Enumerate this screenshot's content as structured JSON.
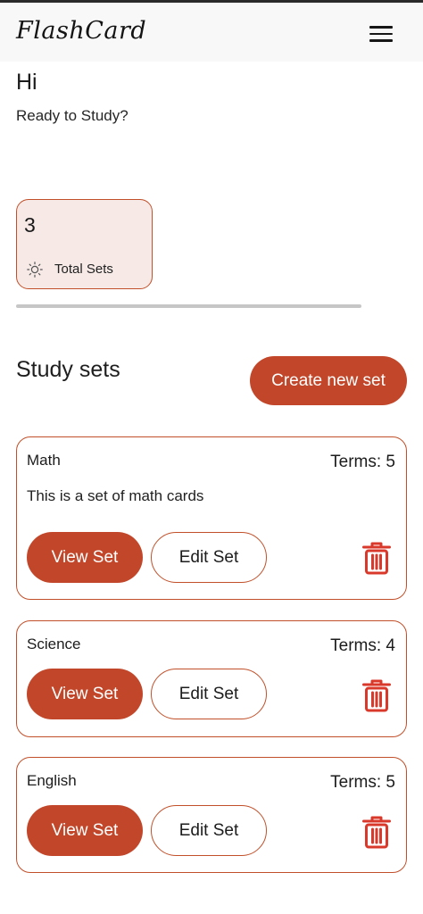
{
  "header": {
    "logo": "FlashCard",
    "menu_icon": "hamburger-menu-icon"
  },
  "greeting": {
    "title": "Hi",
    "subtitle": "Ready to Study?"
  },
  "stats": {
    "total_sets_value": "3",
    "total_sets_label": "Total Sets",
    "icon": "sun-icon"
  },
  "study_sets": {
    "section_title": "Study sets",
    "create_label": "Create new set",
    "sets": [
      {
        "title": "Math",
        "terms": "Terms: 5",
        "description": "This is a set of math cards",
        "view_label": "View Set",
        "edit_label": "Edit Set",
        "delete_icon": "trash-icon"
      },
      {
        "title": "Science",
        "terms": "Terms: 4",
        "description": "",
        "view_label": "View Set",
        "edit_label": "Edit Set",
        "delete_icon": "trash-icon"
      },
      {
        "title": "English",
        "terms": "Terms: 5",
        "description": "",
        "view_label": "View Set",
        "edit_label": "Edit Set",
        "delete_icon": "trash-icon"
      }
    ]
  },
  "colors": {
    "accent": "#c2472a",
    "card_tint": "#f6e9e6",
    "trash": "#d8392b"
  }
}
